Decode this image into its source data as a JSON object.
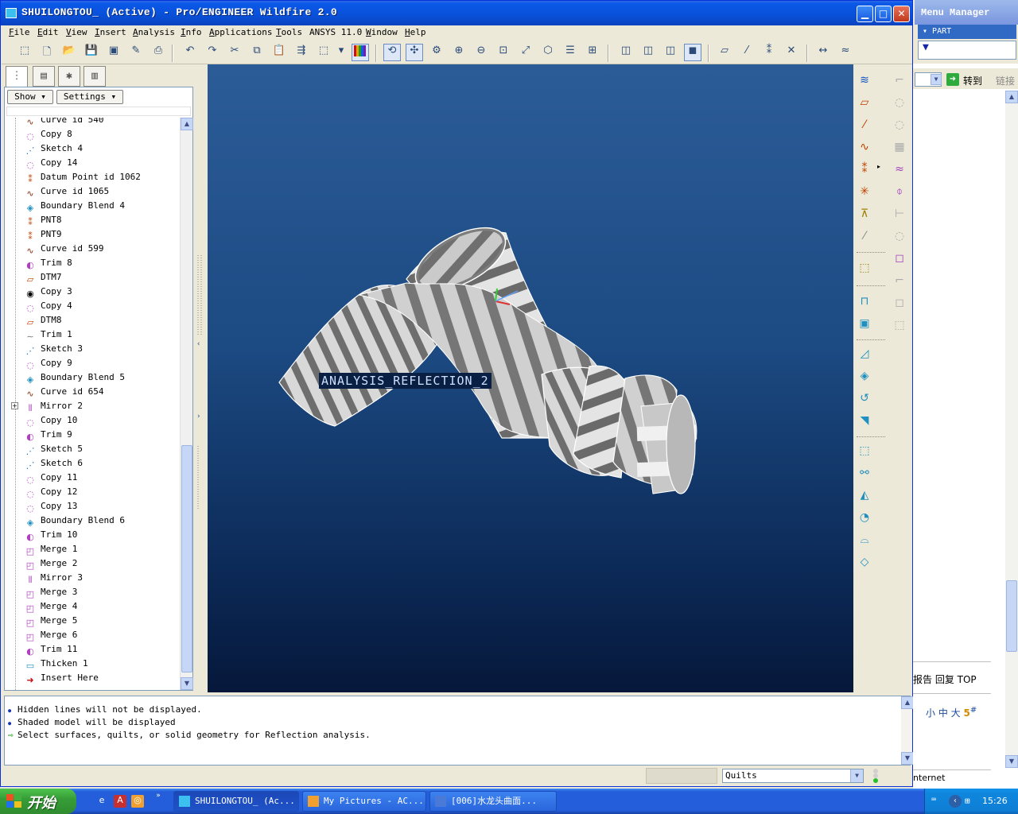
{
  "window": {
    "title": "SHUILONGTOU_ (Active) - Pro/ENGINEER Wildfire 2.0"
  },
  "menubar": [
    {
      "key": "F",
      "rest": "ile"
    },
    {
      "key": "E",
      "rest": "dit"
    },
    {
      "key": "V",
      "rest": "iew"
    },
    {
      "key": "I",
      "rest": "nsert"
    },
    {
      "key": "A",
      "rest": "nalysis"
    },
    {
      "key": "I",
      "rest": "nfo"
    },
    {
      "key": "A",
      "rest": "pplications"
    },
    {
      "key": "T",
      "rest": "ools"
    },
    {
      "key": "",
      "rest": "ANSYS 11.0"
    },
    {
      "key": "W",
      "rest": "indow"
    },
    {
      "key": "H",
      "rest": "elp"
    }
  ],
  "navigator": {
    "show_label": "Show",
    "settings_label": "Settings",
    "tree": [
      {
        "label": "Curve id 540",
        "icon": "curve-icon"
      },
      {
        "label": "Copy 8",
        "icon": "copy-icon"
      },
      {
        "label": "Sketch 4",
        "icon": "sketch-icon"
      },
      {
        "label": "Copy 14",
        "icon": "copy-icon"
      },
      {
        "label": "Datum Point id 1062",
        "icon": "datum-point-icon"
      },
      {
        "label": "Curve id 1065",
        "icon": "curve-icon"
      },
      {
        "label": "Boundary Blend 4",
        "icon": "boundary-blend-icon"
      },
      {
        "label": "PNT8",
        "icon": "datum-point-icon"
      },
      {
        "label": "PNT9",
        "icon": "datum-point-icon"
      },
      {
        "label": "Curve id 599",
        "icon": "curve-icon"
      },
      {
        "label": "Trim 8",
        "icon": "trim-icon"
      },
      {
        "label": "DTM7",
        "icon": "datum-plane-icon"
      },
      {
        "label": "Copy 3",
        "icon": "copy-solid-icon"
      },
      {
        "label": "Copy 4",
        "icon": "copy-icon"
      },
      {
        "label": "DTM8",
        "icon": "datum-plane-icon"
      },
      {
        "label": "Trim 1",
        "icon": "trim-gray-icon"
      },
      {
        "label": "Sketch 3",
        "icon": "sketch-icon"
      },
      {
        "label": "Copy 9",
        "icon": "copy-icon"
      },
      {
        "label": "Boundary Blend 5",
        "icon": "boundary-blend-icon"
      },
      {
        "label": "Curve id 654",
        "icon": "curve-icon"
      },
      {
        "label": "Mirror 2",
        "icon": "mirror-icon",
        "expandable": true
      },
      {
        "label": "Copy 10",
        "icon": "copy-icon"
      },
      {
        "label": "Trim 9",
        "icon": "trim-icon"
      },
      {
        "label": "Sketch 5",
        "icon": "sketch-icon"
      },
      {
        "label": "Sketch 6",
        "icon": "sketch-icon"
      },
      {
        "label": "Copy 11",
        "icon": "copy-icon"
      },
      {
        "label": "Copy 12",
        "icon": "copy-icon"
      },
      {
        "label": "Copy 13",
        "icon": "copy-icon"
      },
      {
        "label": "Boundary Blend 6",
        "icon": "boundary-blend-icon"
      },
      {
        "label": "Trim 10",
        "icon": "trim-icon"
      },
      {
        "label": "Merge 1",
        "icon": "merge-icon"
      },
      {
        "label": "Merge 2",
        "icon": "merge-icon"
      },
      {
        "label": "Mirror 3",
        "icon": "mirror-icon"
      },
      {
        "label": "Merge 3",
        "icon": "merge-icon"
      },
      {
        "label": "Merge 4",
        "icon": "merge-icon"
      },
      {
        "label": "Merge 5",
        "icon": "merge-icon"
      },
      {
        "label": "Merge 6",
        "icon": "merge-icon"
      },
      {
        "label": "Trim 11",
        "icon": "trim-icon"
      },
      {
        "label": "Thicken 1",
        "icon": "thicken-icon"
      },
      {
        "label": "Insert Here",
        "icon": "insert-here-arrow-icon"
      }
    ]
  },
  "viewport": {
    "analysis_label": "ANALYSIS_REFLECTION_2"
  },
  "messages": [
    {
      "type": "info",
      "text": "Hidden lines will not be displayed."
    },
    {
      "type": "info",
      "text": "Shaded model will be displayed"
    },
    {
      "type": "prompt",
      "text": "Select surfaces, quilts, or solid geometry for Reflection analysis."
    }
  ],
  "status": {
    "filter_value": "Quilts"
  },
  "menu_manager": {
    "title": "Menu Manager",
    "part_label": "PART"
  },
  "browser": {
    "go_label": "转到",
    "link_label": "链接",
    "nav_text": "报告 回复 TOP",
    "size_text": "小 中 大 ",
    "size_5": "5",
    "size_sup": "#",
    "status_text": "nternet"
  },
  "taskbar": {
    "start_label": "开始",
    "tasks": [
      {
        "label": "SHUILONGTOU_ (Ac...",
        "active": true
      },
      {
        "label": "My Pictures - AC...",
        "active": false
      },
      {
        "label": "[006]水龙头曲面...",
        "active": false
      }
    ],
    "clock": "15:26"
  },
  "colors": {
    "xp_blue": "#0a58e8",
    "viewport_top": "#2c5c98",
    "viewport_bottom": "#06183a",
    "start_green": "#379d37"
  }
}
